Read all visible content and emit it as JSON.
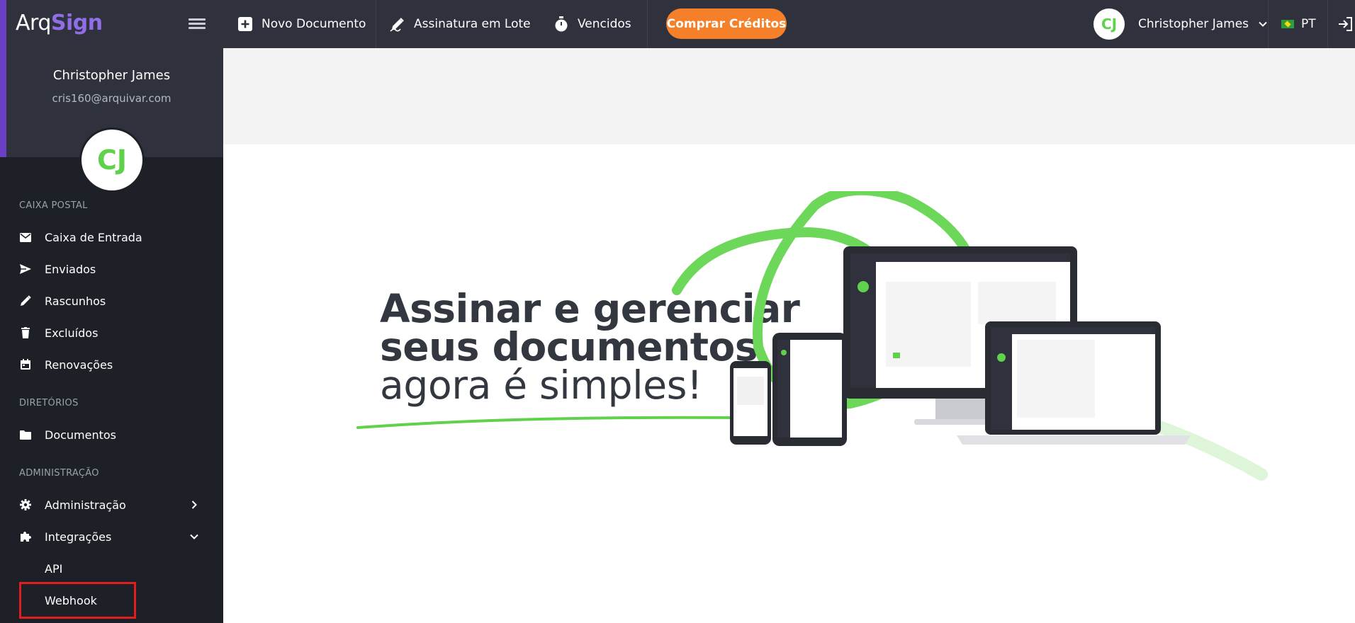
{
  "app": {
    "logo_part1": "Arq",
    "logo_part2": "Sign",
    "brand_colors": {
      "sidebar": "#1e2028",
      "topbar": "#2f323d",
      "accent": "#6a3fc6",
      "cta": "#f6802a",
      "green": "#5fd14a"
    }
  },
  "sidebar": {
    "profile": {
      "name": "Christopher James",
      "email": "cris160@arquivar.com",
      "initials": "CJ"
    },
    "sections": [
      {
        "title": "CAIXA POSTAL",
        "items": [
          {
            "label": "Caixa de Entrada",
            "icon": "envelope-icon"
          },
          {
            "label": "Enviados",
            "icon": "send-icon"
          },
          {
            "label": "Rascunhos",
            "icon": "pencil-icon"
          },
          {
            "label": "Excluídos",
            "icon": "trash-icon"
          },
          {
            "label": "Renovações",
            "icon": "calendar-icon"
          }
        ]
      },
      {
        "title": "DIRETÓRIOS",
        "items": [
          {
            "label": "Documentos",
            "icon": "folder-icon"
          }
        ]
      },
      {
        "title": "ADMINISTRAÇÃO",
        "items": [
          {
            "label": "Administração",
            "icon": "gear-icon",
            "chevron": "chevron-right-icon"
          },
          {
            "label": "Integrações",
            "icon": "puzzle-icon",
            "chevron": "chevron-down-icon",
            "children": [
              "API",
              "Webhook"
            ]
          }
        ]
      }
    ]
  },
  "topbar": {
    "new_document": "Novo Documento",
    "batch_signature": "Assinatura em Lote",
    "expired": "Vencidos",
    "buy_credits": "Comprar Créditos",
    "user_name": "Christopher James",
    "user_initials": "CJ",
    "language": "PT"
  },
  "hero": {
    "line1": "Assinar e gerenciar",
    "line2": "seus documentos",
    "line3": "agora é simples!"
  }
}
